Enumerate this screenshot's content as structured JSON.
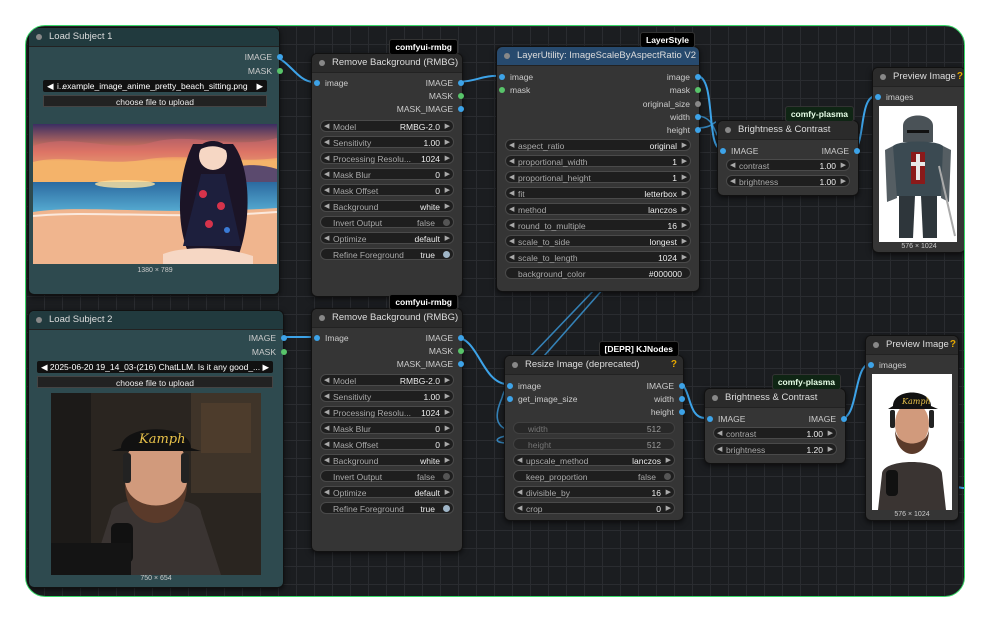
{
  "nodes": {
    "load1": {
      "title": "Load Subject 1",
      "outputs": [
        "IMAGE",
        "MASK"
      ],
      "file": "example_image_anime_pretty_beach_sitting.png",
      "file_prefix": "i...",
      "upload_label": "choose file to upload",
      "dims": "1380 × 789"
    },
    "load2": {
      "title": "Load Subject 2",
      "outputs": [
        "IMAGE",
        "MASK"
      ],
      "file": "2025-06-20 19_14_03-(216) ChatLLM. Is it any good_...",
      "upload_label": "choose file to upload",
      "dims": "750 × 654"
    },
    "rmbg1": {
      "badge": "comfyui-rmbg",
      "title": "Remove Background (RMBG)",
      "input": "image",
      "outputs": [
        "IMAGE",
        "MASK",
        "MASK_IMAGE"
      ],
      "widgets": [
        {
          "label": "Model",
          "value": "RMBG-2.0"
        },
        {
          "label": "Sensitivity",
          "value": "1.00"
        },
        {
          "label": "Processing Resolu...",
          "value": "1024"
        },
        {
          "label": "Mask Blur",
          "value": "0"
        },
        {
          "label": "Mask Offset",
          "value": "0"
        },
        {
          "label": "Background",
          "value": "white"
        },
        {
          "label": "Invert Output",
          "value": "false"
        },
        {
          "label": "Optimize",
          "value": "default"
        },
        {
          "label": "Refine Foreground",
          "value": "true"
        }
      ]
    },
    "rmbg2": {
      "badge": "comfyui-rmbg",
      "title": "Remove Background (RMBG)",
      "input": "Image",
      "outputs": [
        "IMAGE",
        "MASK",
        "MASK_IMAGE"
      ],
      "widgets": [
        {
          "label": "Model",
          "value": "RMBG-2.0"
        },
        {
          "label": "Sensitivity",
          "value": "1.00"
        },
        {
          "label": "Processing Resolu...",
          "value": "1024"
        },
        {
          "label": "Mask Blur",
          "value": "0"
        },
        {
          "label": "Mask Offset",
          "value": "0"
        },
        {
          "label": "Background",
          "value": "white"
        },
        {
          "label": "Invert Output",
          "value": "false"
        },
        {
          "label": "Optimize",
          "value": "default"
        },
        {
          "label": "Refine Foreground",
          "value": "true"
        }
      ]
    },
    "scale": {
      "badge": "LayerStyle",
      "title": "LayerUtility: ImageScaleByAspectRatio V2",
      "inputs": [
        "image",
        "mask"
      ],
      "outputs": [
        "image",
        "mask",
        "original_size",
        "width",
        "height"
      ],
      "widgets": [
        {
          "label": "aspect_ratio",
          "value": "original"
        },
        {
          "label": "proportional_width",
          "value": "1"
        },
        {
          "label": "proportional_height",
          "value": "1"
        },
        {
          "label": "fit",
          "value": "letterbox"
        },
        {
          "label": "method",
          "value": "lanczos"
        },
        {
          "label": "round_to_multiple",
          "value": "16"
        },
        {
          "label": "scale_to_side",
          "value": "longest"
        },
        {
          "label": "scale_to_length",
          "value": "1024"
        },
        {
          "label": "background_color",
          "value": "#000000"
        }
      ]
    },
    "resize": {
      "badge": "[DEPR] KJNodes",
      "title": "Resize Image (deprecated)",
      "inputs": [
        "image",
        "get_image_size"
      ],
      "outputs": [
        "IMAGE",
        "width",
        "height"
      ],
      "widgets": [
        {
          "label": "width",
          "value": "512"
        },
        {
          "label": "height",
          "value": "512"
        },
        {
          "label": "upscale_method",
          "value": "lanczos"
        },
        {
          "label": "keep_proportion",
          "value": "false"
        },
        {
          "label": "divisible_by",
          "value": "16"
        },
        {
          "label": "crop",
          "value": "0"
        }
      ]
    },
    "bc1": {
      "badge": "comfy-plasma",
      "title": "Brightness & Contrast",
      "input": "IMAGE",
      "output": "IMAGE",
      "widgets": [
        {
          "label": "contrast",
          "value": "1.00"
        },
        {
          "label": "brightness",
          "value": "1.00"
        }
      ]
    },
    "bc2": {
      "badge": "comfy-plasma",
      "title": "Brightness & Contrast",
      "input": "IMAGE",
      "output": "IMAGE",
      "widgets": [
        {
          "label": "contrast",
          "value": "1.00"
        },
        {
          "label": "brightness",
          "value": "1.20"
        }
      ]
    },
    "preview1": {
      "title": "Preview Image",
      "input": "images",
      "dims": "576 × 1024"
    },
    "preview2": {
      "title": "Preview Image",
      "input": "images",
      "dims": "576 × 1024"
    }
  },
  "images": {
    "anime_cap": "Kamph"
  },
  "colors": {
    "link": "#3da3e8",
    "canvas": "#1b1d20",
    "border": "#38d868",
    "badge_warn": "#e6a800"
  }
}
